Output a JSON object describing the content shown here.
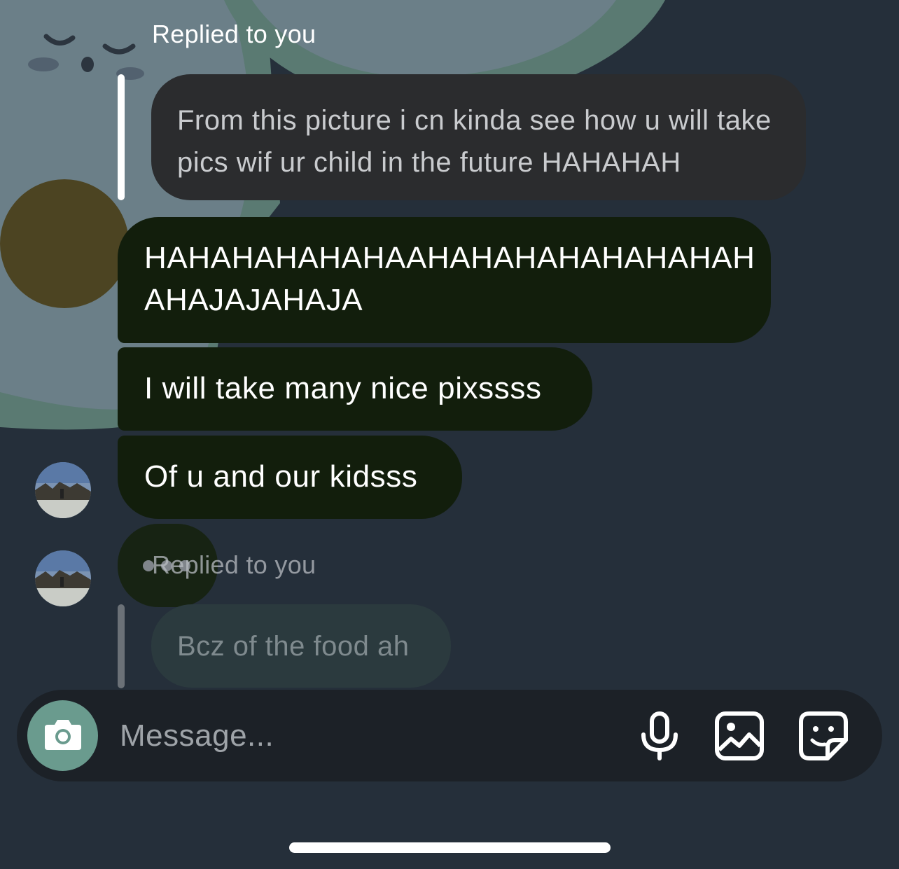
{
  "thread": {
    "reply_label": "Replied to you",
    "quoted_message": "From this picture i cn kinda see how u will take pics wif ur child in the future HAHAHAH",
    "messages": [
      "HAHAHAHAHAHAAHAHAHAHAHAHAHAH AHAJAJAHAJA",
      "I will take many nice pixssss",
      "Of u and our kidsss"
    ],
    "second_reply_label": "Replied to you",
    "second_quoted_message": "Bcz of the food ah"
  },
  "composer": {
    "placeholder": "Message..."
  },
  "icons": {
    "camera": "camera-icon",
    "mic": "microphone-icon",
    "gallery": "gallery-icon",
    "sticker": "sticker-icon"
  },
  "colors": {
    "background": "#252f3a",
    "sent_bubble": "#121e0c",
    "quoted_bubble": "#2b2c2e",
    "camera_button": "#6a9b8e"
  }
}
